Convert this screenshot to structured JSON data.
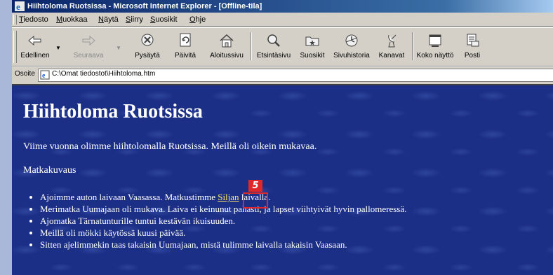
{
  "window": {
    "title": "Hiihtoloma Ruotsissa - Microsoft Internet Explorer - [Offline-tila]"
  },
  "menu": [
    "Tiedosto",
    "Muokkaa",
    "Näytä",
    "Siirry",
    "Suosikit",
    "Ohje"
  ],
  "toolbar": {
    "back": "Edellinen",
    "forward": "Seuraava",
    "stop": "Pysäytä",
    "refresh": "Päivitä",
    "home": "Aloitussivu",
    "search": "Etsintäsivu",
    "favorites": "Suosikit",
    "history": "Sivuhistoria",
    "channels": "Kanavat",
    "fullscreen": "Koko näyttö",
    "mail": "Posti"
  },
  "address": {
    "label": "Osoite",
    "value": "C:\\Omat tiedostot\\Hiihtoloma.htm"
  },
  "page": {
    "heading": "Hiihtoloma Ruotsissa",
    "intro": "Viime vuonna olimme hiihtolomalla Ruotsissa. Meillä oli oikein mukavaa.",
    "subheading": "Matkakuvaus",
    "list": {
      "item1_before": "Ajoimme auton laivaan Vaasassa. Matkustimme ",
      "item1_link": "Siljan",
      "item1_after": " laivalla.",
      "item2": "Merimatka Uumajaan oli mukava. Laiva ei keinunut pahasti, ja lapset viihtyivät hyvin pallomeressä.",
      "item3": "Ajomatka Tärnatunturille tuntui kestävän ikuisuuden.",
      "item4": "Meillä oli mökki käytössä kuusi päivää.",
      "item5": "Sitten ajelimmekin taas takaisin Uumajaan, mistä tulimme laivalla takaisin Vaasaan."
    }
  },
  "callout": {
    "number": "5",
    "color": "#e0282a"
  },
  "colors": {
    "page_background": "#1c2f86",
    "link": "#ffe36a",
    "titlebar": "#0a246a"
  }
}
